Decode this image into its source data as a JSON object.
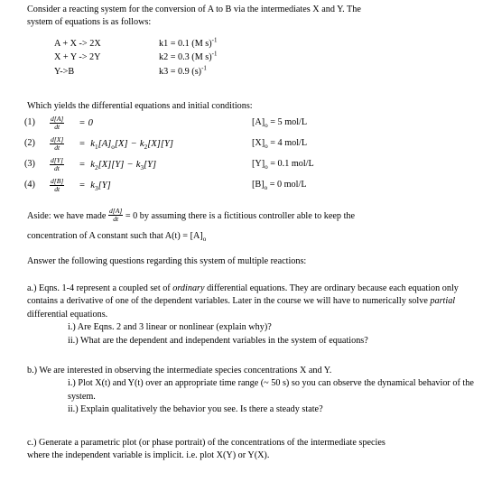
{
  "document": {
    "intro": {
      "line1": "Consider a reacting system for the conversion of A to B via the intermediates X and Y.  The",
      "line2": "system of equations is as follows:"
    },
    "reactions": [
      {
        "equation": "A + X -> 2X",
        "rate_label": "k1",
        "rate_value": "= 0.1 (M s)",
        "rate_exponent": "-1"
      },
      {
        "equation": "X + Y -> 2Y",
        "rate_label": "k2",
        "rate_value": "= 0.3 (M s)",
        "rate_exponent": "-1"
      },
      {
        "equation": "Y->B",
        "rate_label": "k3",
        "rate_value": "= 0.9 (s)",
        "rate_exponent": "-1"
      }
    ],
    "yields_line": "Which yields the differential equations and initial conditions:",
    "equations": [
      {
        "number": "(1)",
        "frac_num": "d[A]",
        "frac_den": "dt",
        "rhs": "= 0",
        "ic": "[A]o = 5 mol/L",
        "ic_species": "[A]",
        "ic_sub": "o",
        "ic_rest": "= 5 mol/L"
      },
      {
        "number": "(2)",
        "frac_num": "d[X]",
        "frac_den": "dt",
        "rhs": "= k1[A]o[X] − k2[X][Y]",
        "ic": "[X]o = 4 mol/L",
        "ic_species": "[X]",
        "ic_sub": "o",
        "ic_rest": "= 4 mol/L"
      },
      {
        "number": "(3)",
        "frac_num": "d[Y]",
        "frac_den": "dt",
        "rhs": "= k2[X][Y] − k3[Y]",
        "ic": "[Y]o = 0.1 mol/L",
        "ic_species": "[Y]",
        "ic_sub": "o",
        "ic_rest": "= 0.1 mol/L"
      },
      {
        "number": "(4)",
        "frac_num": "d[B]",
        "frac_den": "dt",
        "rhs": "= k3[Y]",
        "ic": "[B]o = 0 mol/L",
        "ic_species": "[B]",
        "ic_sub": "o",
        "ic_rest": "= 0 mol/L"
      }
    ],
    "aside": {
      "prefix": "Aside: we have made ",
      "frac_num": "d[A]",
      "frac_den": "dt",
      "middle": " = 0 by assuming there is a fictitious controller able to keep the",
      "line2_prefix": "concentration of A constant such that A(t) = [A]",
      "line2_sub": "o"
    },
    "answer_prompt": "Answer the following questions regarding this system of multiple reactions:",
    "question_a": {
      "text_part1": "a.) Eqns. 1-4 represent a coupled set of ",
      "italic1": "ordinary",
      "text_part2": " differential equations.  They are ordinary because each equation only contains a derivative of one of the dependent variables.  Later in the course we will have to numerically solve ",
      "italic2": "partial",
      "text_part3": " differential equations.",
      "sub_items": [
        "i.) Are Eqns. 2 and 3 linear or nonlinear (explain why)?",
        "ii.) What are the dependent and independent variables in the system of equations?"
      ]
    },
    "question_b": {
      "text": "b.) We are interested in observing the intermediate species concentrations X and Y.",
      "sub_items": [
        "i.) Plot X(t) and Y(t) over an appropriate time range (~ 50 s) so you can observe the dynamical behavior of the system.",
        "ii.) Explain qualitatively the behavior you see. Is there a steady state?"
      ]
    },
    "question_c": {
      "line1": "c.) Generate a parametric plot (or phase portrait) of the concentrations of the intermediate species",
      "line2": "where the independent variable is implicit. i.e. plot X(Y) or Y(X)."
    }
  }
}
